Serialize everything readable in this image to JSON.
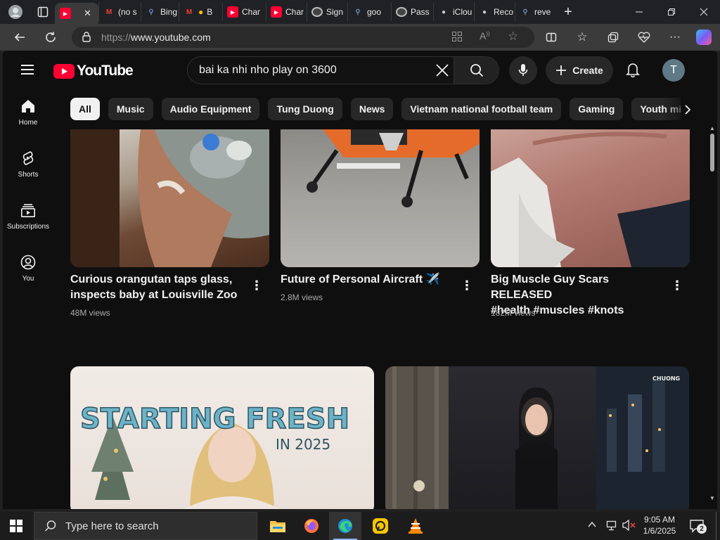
{
  "browser": {
    "tabs": [
      {
        "label": "",
        "icon": "youtube-icon",
        "active": true
      },
      {
        "label": "(no s",
        "icon": "gmail-icon"
      },
      {
        "label": "Bing",
        "icon": "search-icon"
      },
      {
        "label": "B",
        "icon": "gmail-icon"
      },
      {
        "label": "Char",
        "icon": "youtube-icon"
      },
      {
        "label": "Char",
        "icon": "youtube-icon"
      },
      {
        "label": "Sign",
        "icon": "google-icon"
      },
      {
        "label": "goo",
        "icon": "search-icon"
      },
      {
        "label": "Pass",
        "icon": "google-icon"
      },
      {
        "label": "iClou",
        "icon": "apple-icon"
      },
      {
        "label": "Reco",
        "icon": "apple-icon"
      },
      {
        "label": "reve",
        "icon": "search-icon"
      }
    ],
    "new_tab_symbol": "+",
    "close_symbol": "✕",
    "url_prefix": "https://",
    "url_host": "www.youtube.com"
  },
  "youtube": {
    "logo_text": "YouTube",
    "search_value": "bai ka nhi nho play on 3600",
    "create_label": "Create",
    "avatar_letter": "T",
    "sidebar": [
      {
        "label": "Home",
        "icon": "home-icon"
      },
      {
        "label": "Shorts",
        "icon": "shorts-icon"
      },
      {
        "label": "Subscriptions",
        "icon": "subscriptions-icon"
      },
      {
        "label": "You",
        "icon": "you-icon"
      }
    ],
    "chips": [
      "All",
      "Music",
      "Audio Equipment",
      "Tung Duong",
      "News",
      "Vietnam national football team",
      "Gaming",
      "Youth mi"
    ],
    "videos": [
      {
        "title_line1": "Curious orangutan taps glass,",
        "title_line2": "inspects baby at Louisville Zoo",
        "views": "48M views"
      },
      {
        "title_line1": "Future of Personal Aircraft ✈️",
        "title_line2": "",
        "views": "2.8M views"
      },
      {
        "title_line1": "Big Muscle Guy Scars RELEASED",
        "title_line2": "#health #muscles #knots",
        "views": "182M views"
      }
    ],
    "thumb_text": {
      "starting": "STARTING FRESH",
      "in_year": "IN 2025",
      "channel_badge": "CHUONG"
    }
  },
  "taskbar": {
    "search_placeholder": "Type here to search",
    "time": "9:05 AM",
    "date": "1/6/2025",
    "notification_count": "2"
  },
  "colors": {
    "yt_red": "#ff0033",
    "page_bg": "#0f0f0f",
    "chip_bg": "#272727",
    "accent": "#8ab4f8"
  }
}
